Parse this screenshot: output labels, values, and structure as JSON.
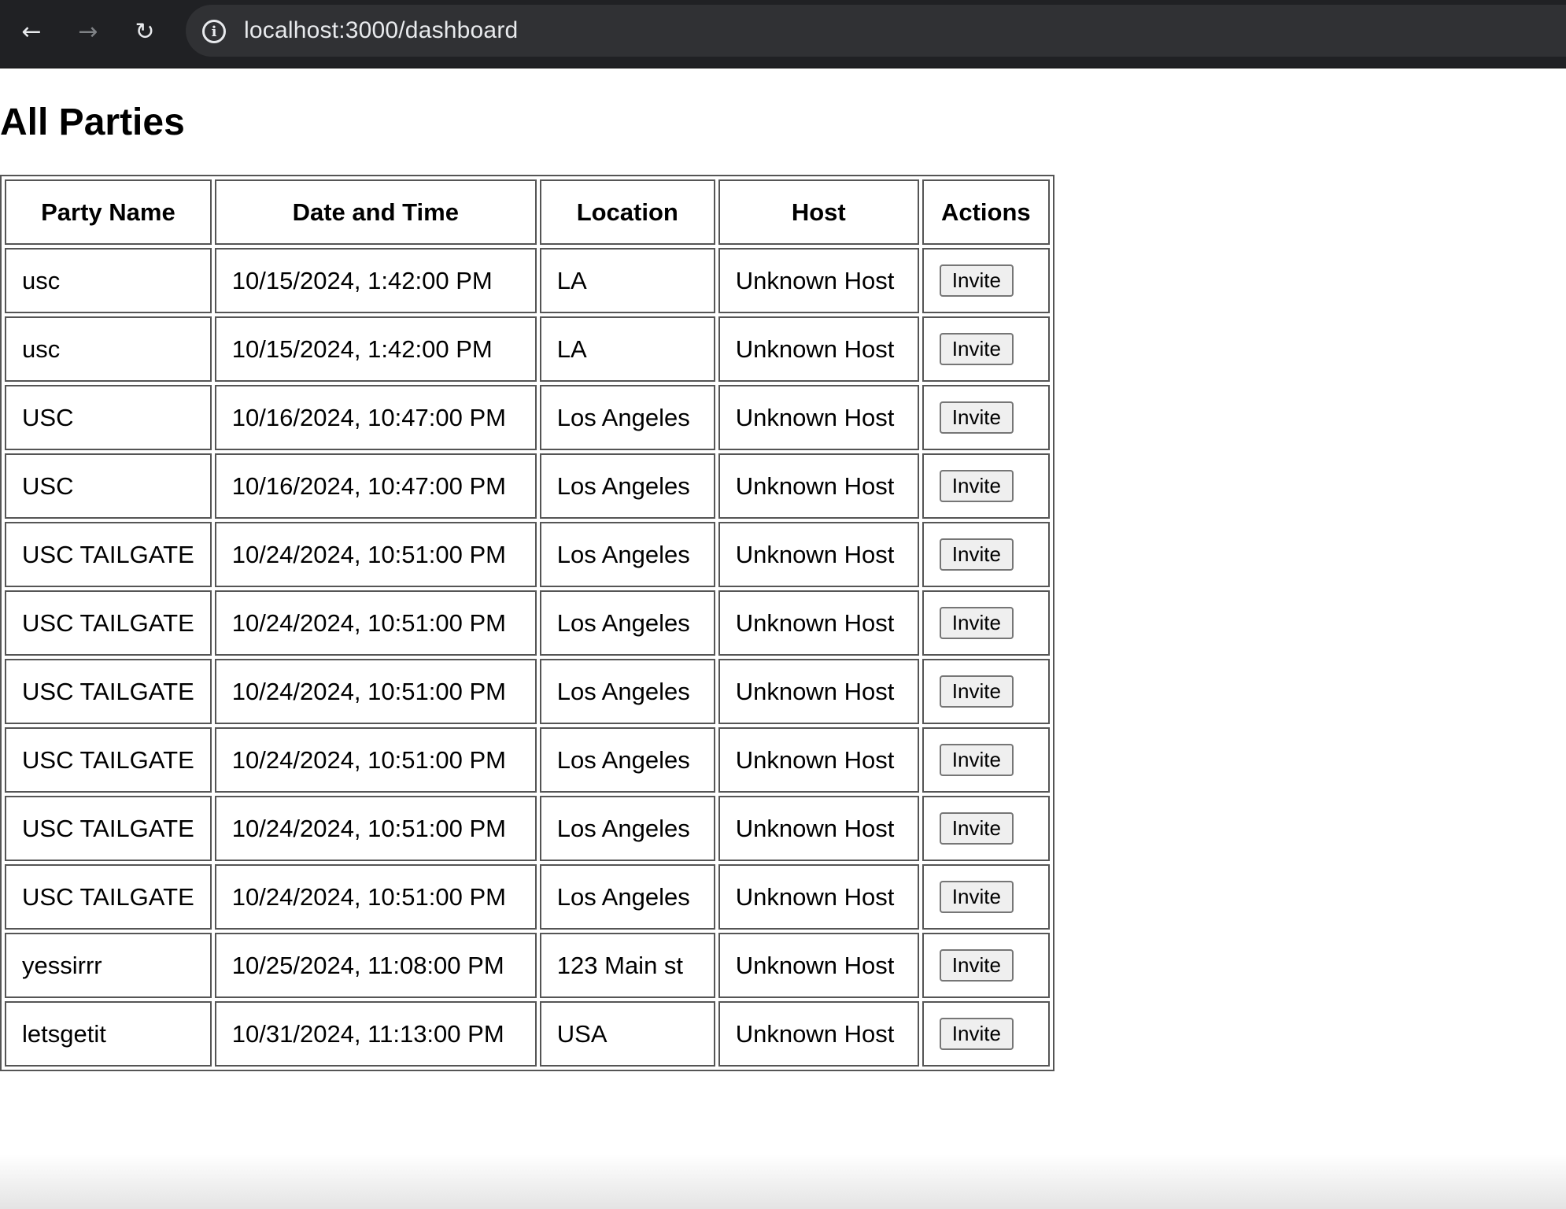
{
  "browser": {
    "url": "localhost:3000/dashboard",
    "icons": {
      "back": "arrow-left-icon",
      "forward": "arrow-right-icon",
      "reload": "reload-icon",
      "info": "info-icon"
    }
  },
  "page": {
    "title": "All Parties"
  },
  "table": {
    "headers": [
      "Party Name",
      "Date and Time",
      "Location",
      "Host",
      "Actions"
    ],
    "rows": [
      {
        "name": "usc",
        "datetime": "10/15/2024, 1:42:00 PM",
        "location": "LA",
        "host": "Unknown Host",
        "action": "Invite"
      },
      {
        "name": "usc",
        "datetime": "10/15/2024, 1:42:00 PM",
        "location": "LA",
        "host": "Unknown Host",
        "action": "Invite"
      },
      {
        "name": "USC",
        "datetime": "10/16/2024, 10:47:00 PM",
        "location": "Los Angeles",
        "host": "Unknown Host",
        "action": "Invite"
      },
      {
        "name": "USC",
        "datetime": "10/16/2024, 10:47:00 PM",
        "location": "Los Angeles",
        "host": "Unknown Host",
        "action": "Invite"
      },
      {
        "name": "USC TAILGATE",
        "datetime": "10/24/2024, 10:51:00 PM",
        "location": "Los Angeles",
        "host": "Unknown Host",
        "action": "Invite"
      },
      {
        "name": "USC TAILGATE",
        "datetime": "10/24/2024, 10:51:00 PM",
        "location": "Los Angeles",
        "host": "Unknown Host",
        "action": "Invite"
      },
      {
        "name": "USC TAILGATE",
        "datetime": "10/24/2024, 10:51:00 PM",
        "location": "Los Angeles",
        "host": "Unknown Host",
        "action": "Invite"
      },
      {
        "name": "USC TAILGATE",
        "datetime": "10/24/2024, 10:51:00 PM",
        "location": "Los Angeles",
        "host": "Unknown Host",
        "action": "Invite"
      },
      {
        "name": "USC TAILGATE",
        "datetime": "10/24/2024, 10:51:00 PM",
        "location": "Los Angeles",
        "host": "Unknown Host",
        "action": "Invite"
      },
      {
        "name": "USC TAILGATE",
        "datetime": "10/24/2024, 10:51:00 PM",
        "location": "Los Angeles",
        "host": "Unknown Host",
        "action": "Invite"
      },
      {
        "name": "yessirrr",
        "datetime": "10/25/2024, 11:08:00 PM",
        "location": "123 Main st",
        "host": "Unknown Host",
        "action": "Invite"
      },
      {
        "name": "letsgetit",
        "datetime": "10/31/2024, 11:13:00 PM",
        "location": "USA",
        "host": "Unknown Host",
        "action": "Invite"
      }
    ]
  }
}
